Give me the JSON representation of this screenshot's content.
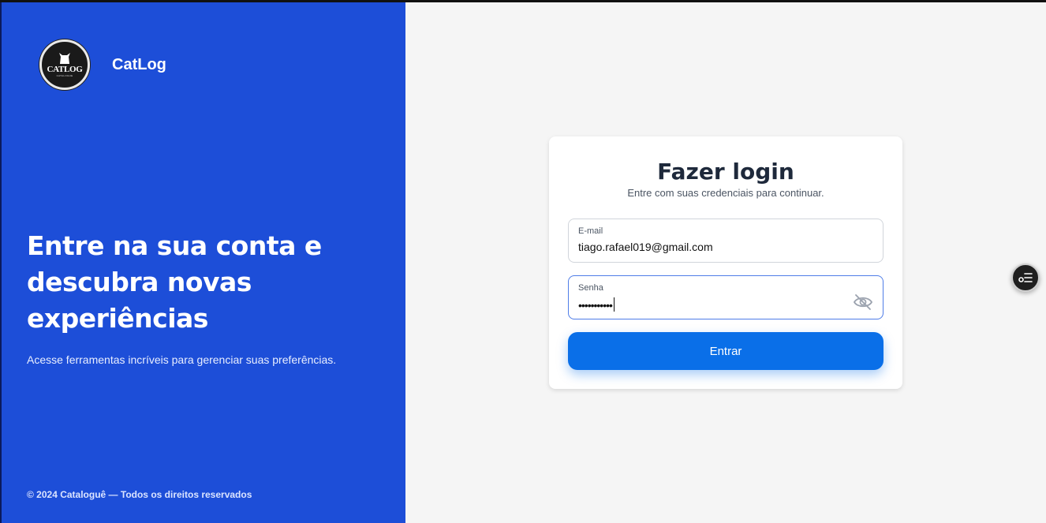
{
  "brand": {
    "logo_text": "CATLOG",
    "logo_subtext": "CATALOGUE",
    "name": "CatLog"
  },
  "hero": {
    "title": "Entre na sua conta e descubra novas experiências",
    "subtitle": "Acesse ferramentas incríveis para gerenciar suas preferências."
  },
  "footer": {
    "text": "© 2024 Cataloguê — Todos os direitos reservados"
  },
  "login": {
    "title": "Fazer login",
    "subtitle": "Entre com suas credenciais para continuar.",
    "email_label": "E-mail",
    "email_value": "tiago.rafael019@gmail.com",
    "password_label": "Senha",
    "password_masked": "•••••••••••",
    "submit_label": "Entrar"
  },
  "icons": {
    "password_toggle": "eye-off-icon",
    "floating": "list-settings-icon"
  },
  "colors": {
    "panel": "#1d4ed8",
    "button": "#0a6fe8",
    "background": "#f5f5f5"
  }
}
